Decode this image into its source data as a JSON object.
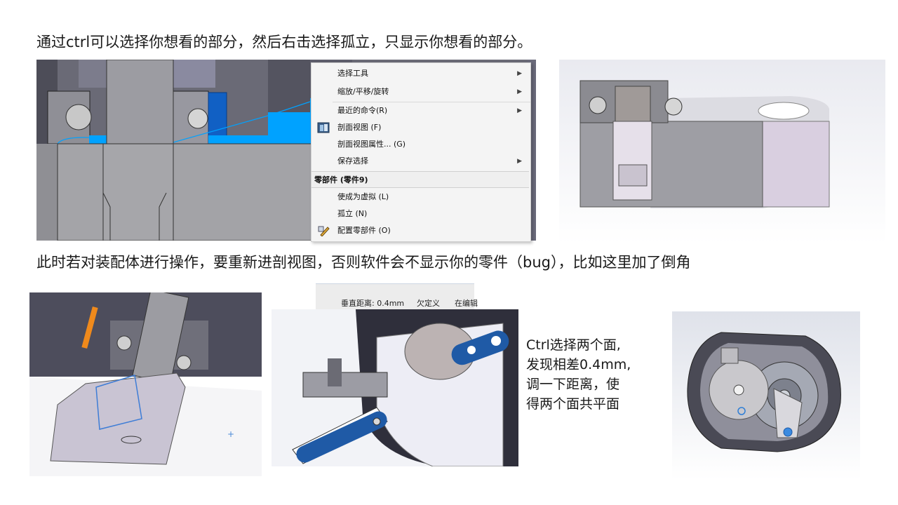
{
  "headings": {
    "top": "通过ctrl可以选择你想看的部分，然后右击选择孤立，只显示你想看的部分。",
    "middle": "此时若对装配体进行操作，要重新进剖视图，否则软件会不显示你的零件（bug），比如这里加了倒角"
  },
  "context_menu": {
    "items_top": [
      {
        "label": "选择工具",
        "has_submenu": true
      },
      {
        "label": "缩放/平移/旋转",
        "has_submenu": true
      },
      {
        "label": "最近的命令(R)",
        "has_submenu": true
      },
      {
        "label": "剖面视图 (F)",
        "icon": "section-view-icon"
      },
      {
        "label": "剖面视图属性... (G)"
      },
      {
        "label": "保存选择",
        "has_submenu": true
      }
    ],
    "section_header": "零部件 (零件9)",
    "items_bottom": [
      {
        "label": "使成为虚拟 (L)"
      },
      {
        "label": "孤立 (N)"
      },
      {
        "label": "配置零部件 (O)",
        "icon": "configure-component-icon"
      }
    ]
  },
  "status_bar": {
    "distance": "垂直距离: 0.4mm",
    "state": "欠定义",
    "editing": "在编辑"
  },
  "note": {
    "line1": "Ctrl选择两个面,",
    "line2": "发现相差0.4mm,",
    "line3": "调一下距离，使",
    "line4": "得两个面共平面"
  },
  "colors": {
    "selection_blue": "#00a2ff",
    "edge_blue": "#1f5aa6",
    "part_gray": "#a9a9ad",
    "dark_gray": "#5b5b66",
    "highlight_orange": "#f08a1c"
  }
}
